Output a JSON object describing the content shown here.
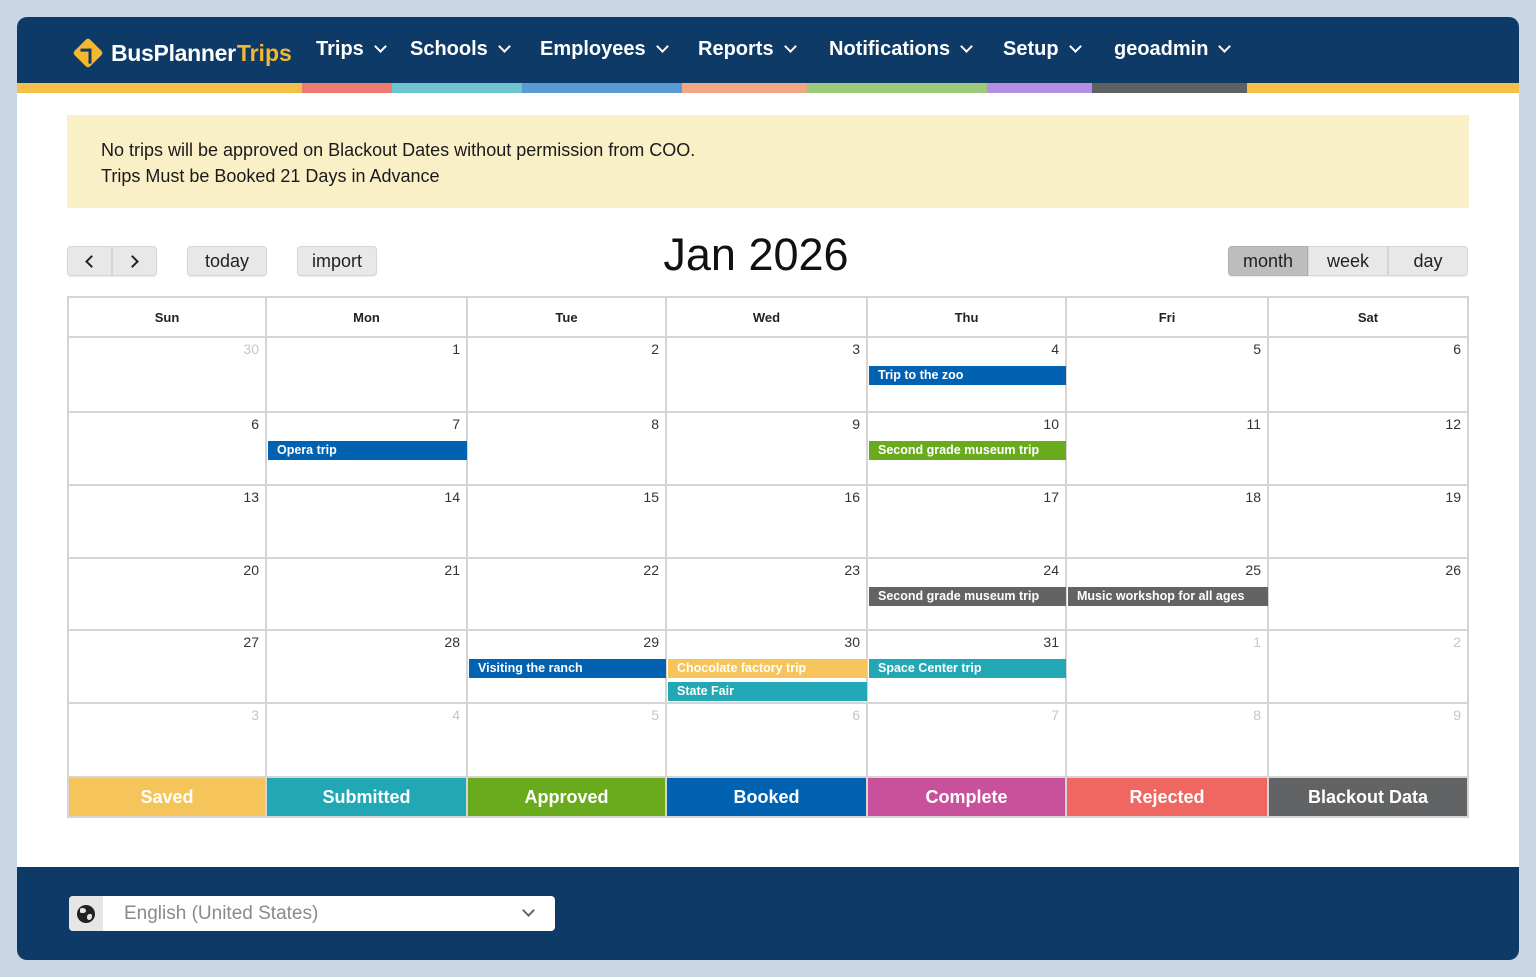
{
  "app": {
    "logo_main": "BusPlanner",
    "logo_accent": "Trips"
  },
  "nav": {
    "items": [
      {
        "label": "Trips"
      },
      {
        "label": "Schools"
      },
      {
        "label": "Employees"
      },
      {
        "label": "Reports"
      },
      {
        "label": "Notifications"
      },
      {
        "label": "Setup"
      },
      {
        "label": "geoadmin"
      }
    ],
    "stripe_colors": [
      "#f5c04a",
      "#ee7a72",
      "#6cc4cf",
      "#5b9bd5",
      "#f0a884",
      "#9cc97a",
      "#b48ee0",
      "#5f6062",
      "#f5c04a"
    ]
  },
  "notice": {
    "line1": "No trips will be approved on Blackout Dates without permission from COO.",
    "line2": "Trips Must be Booked 21 Days in Advance"
  },
  "toolbar": {
    "prev_icon": "chevron-left-icon",
    "next_icon": "chevron-right-icon",
    "today": "today",
    "import": "import",
    "title": "Jan 2026",
    "views": [
      "month",
      "week",
      "day"
    ],
    "active_view": "month"
  },
  "calendar": {
    "weekdays": [
      "Sun",
      "Mon",
      "Tue",
      "Wed",
      "Thu",
      "Fri",
      "Sat"
    ],
    "weeks": [
      [
        {
          "n": "30",
          "o": true
        },
        {
          "n": "1"
        },
        {
          "n": "2"
        },
        {
          "n": "3"
        },
        {
          "n": "4"
        },
        {
          "n": "5"
        },
        {
          "n": "6"
        }
      ],
      [
        {
          "n": "6"
        },
        {
          "n": "7"
        },
        {
          "n": "8"
        },
        {
          "n": "9"
        },
        {
          "n": "10"
        },
        {
          "n": "11"
        },
        {
          "n": "12"
        }
      ],
      [
        {
          "n": "13"
        },
        {
          "n": "14"
        },
        {
          "n": "15"
        },
        {
          "n": "16"
        },
        {
          "n": "17"
        },
        {
          "n": "18"
        },
        {
          "n": "19"
        }
      ],
      [
        {
          "n": "20"
        },
        {
          "n": "21"
        },
        {
          "n": "22"
        },
        {
          "n": "23"
        },
        {
          "n": "24"
        },
        {
          "n": "25"
        },
        {
          "n": "26"
        }
      ],
      [
        {
          "n": "27"
        },
        {
          "n": "28"
        },
        {
          "n": "29"
        },
        {
          "n": "30"
        },
        {
          "n": "31"
        },
        {
          "n": "1",
          "o": true
        },
        {
          "n": "2",
          "o": true
        }
      ],
      [
        {
          "n": "3",
          "o": true
        },
        {
          "n": "4",
          "o": true
        },
        {
          "n": "5",
          "o": true
        },
        {
          "n": "6",
          "o": true
        },
        {
          "n": "7",
          "o": true
        },
        {
          "n": "8",
          "o": true
        },
        {
          "n": "9",
          "o": true
        }
      ]
    ],
    "events": [
      {
        "label": "Trip to the zoo",
        "week": 0,
        "day": 4,
        "slot": 0,
        "status": "Booked"
      },
      {
        "label": "Opera trip",
        "week": 1,
        "day": 1,
        "slot": 0,
        "status": "Booked"
      },
      {
        "label": "Second grade museum trip",
        "week": 1,
        "day": 4,
        "slot": 0,
        "status": "Approved"
      },
      {
        "label": "Second grade museum trip",
        "week": 3,
        "day": 4,
        "slot": 0,
        "status": "Blackout Data"
      },
      {
        "label": "Music workshop for all ages",
        "week": 3,
        "day": 5,
        "slot": 0,
        "status": "Blackout Data"
      },
      {
        "label": "Visiting the ranch",
        "week": 4,
        "day": 2,
        "slot": 0,
        "status": "Booked"
      },
      {
        "label": "Chocolate factory trip",
        "week": 4,
        "day": 3,
        "slot": 0,
        "status": "Saved"
      },
      {
        "label": "State Fair",
        "week": 4,
        "day": 3,
        "slot": 1,
        "status": "Submitted"
      },
      {
        "label": "Space Center trip",
        "week": 4,
        "day": 4,
        "slot": 0,
        "status": "Submitted"
      }
    ],
    "legend": [
      {
        "label": "Saved",
        "color": "#f5c45a"
      },
      {
        "label": "Submitted",
        "color": "#22a7b5"
      },
      {
        "label": "Approved",
        "color": "#6aab1e"
      },
      {
        "label": "Booked",
        "color": "#0062b1"
      },
      {
        "label": "Complete",
        "color": "#c9519b"
      },
      {
        "label": "Rejected",
        "color": "#ef6760"
      },
      {
        "label": "Blackout Data",
        "color": "#626365"
      }
    ]
  },
  "footer": {
    "language": "English (United States)"
  }
}
